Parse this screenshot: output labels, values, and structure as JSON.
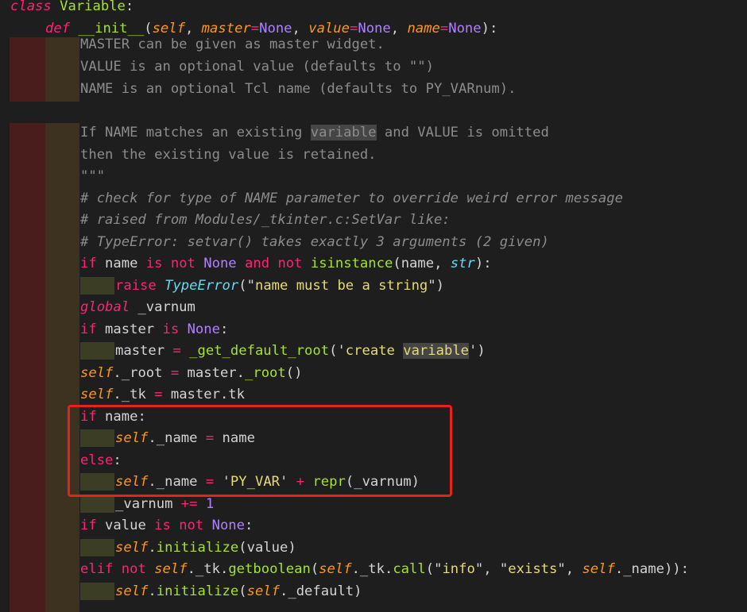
{
  "editor": {
    "colors": {
      "background": "#1e1e1e",
      "keyword": "#f92672",
      "function_name": "#a6e22e",
      "parameter": "#fd971f",
      "constant": "#ae81ff",
      "string": "#e6db74",
      "comment": "#8c8c8c",
      "builtin_type": "#66d9ef",
      "text": "#d4d4d4",
      "indent_guide_red": "#4a1d1d",
      "indent_guide_brown": "#3d3220",
      "indent_guide_olive": "#3b3d24",
      "highlight_box": "#e5231b"
    },
    "lines": [
      [
        [
          "class",
          "kw it"
        ],
        [
          " "
        ],
        [
          "Variable",
          "fn"
        ],
        [
          ":",
          "pn"
        ]
      ],
      [
        [
          "def",
          "kw it"
        ],
        [
          " "
        ],
        [
          "__init__",
          "fn"
        ],
        [
          "(",
          "pn"
        ],
        [
          "self",
          "par it"
        ],
        [
          ", ",
          "pn"
        ],
        [
          "master",
          "par it"
        ],
        [
          "=",
          "kw"
        ],
        [
          "None",
          "cst"
        ],
        [
          ", ",
          "pn"
        ],
        [
          "value",
          "par it"
        ],
        [
          "=",
          "kw"
        ],
        [
          "None",
          "cst"
        ],
        [
          ", ",
          "pn"
        ],
        [
          "name",
          "par it"
        ],
        [
          "=",
          "kw"
        ],
        [
          "None",
          "cst"
        ],
        [
          "):",
          "pn"
        ]
      ],
      [
        [
          "MASTER can be given as master widget.",
          "cm"
        ]
      ],
      [
        [
          "VALUE is an optional value (defaults to \"\")",
          "cm"
        ]
      ],
      [
        [
          "NAME is an optional Tcl name (defaults to PY_VARnum).",
          "cm"
        ]
      ],
      [],
      [
        [
          "If NAME matches an existing ",
          "cm"
        ],
        [
          "variable",
          "cm hl"
        ],
        [
          " and VALUE is omitted",
          "cm"
        ]
      ],
      [
        [
          "then the existing value is retained.",
          "cm"
        ]
      ],
      [
        [
          "\"\"\"",
          "cm"
        ]
      ],
      [
        [
          "# check for type of NAME parameter to override weird error message",
          "cm it"
        ]
      ],
      [
        [
          "# raised from Modules/_tkinter.c:SetVar like:",
          "cm it"
        ]
      ],
      [
        [
          "# TypeError: setvar() takes exactly 3 arguments (2 given)",
          "cm it"
        ]
      ],
      [
        [
          "if",
          "kw"
        ],
        [
          " name "
        ],
        [
          "is",
          "kw"
        ],
        [
          " "
        ],
        [
          "not",
          "kw"
        ],
        [
          " "
        ],
        [
          "None",
          "cst"
        ],
        [
          " "
        ],
        [
          "and",
          "kw"
        ],
        [
          " "
        ],
        [
          "not",
          "kw"
        ],
        [
          " "
        ],
        [
          "isinstance",
          "fn"
        ],
        [
          "(",
          "pn"
        ],
        [
          "name"
        ],
        [
          ", ",
          "pn"
        ],
        [
          "str",
          "bt it"
        ],
        [
          "):",
          "pn"
        ]
      ],
      [
        [
          "raise",
          "kw"
        ],
        [
          " "
        ],
        [
          "TypeError",
          "bt it"
        ],
        [
          "(",
          "pn"
        ],
        [
          "\"",
          "pn"
        ],
        [
          "name must be a string",
          "str"
        ],
        [
          "\"",
          "pn"
        ],
        [
          ")",
          "pn"
        ]
      ],
      [
        [
          "global",
          "kw it"
        ],
        [
          " _varnum"
        ]
      ],
      [
        [
          "if",
          "kw"
        ],
        [
          " master "
        ],
        [
          "is",
          "kw"
        ],
        [
          " "
        ],
        [
          "None",
          "cst"
        ],
        [
          ":",
          "pn"
        ]
      ],
      [
        [
          "master "
        ],
        [
          "=",
          "kw"
        ],
        [
          " "
        ],
        [
          "_get_default_root",
          "fn"
        ],
        [
          "(",
          "pn"
        ],
        [
          "'",
          "pn"
        ],
        [
          "create ",
          "str"
        ],
        [
          "variable",
          "str hl"
        ],
        [
          "'",
          "pn"
        ],
        [
          ")",
          "pn"
        ]
      ],
      [
        [
          "self",
          "par it"
        ],
        [
          "._root "
        ],
        [
          "=",
          "kw"
        ],
        [
          " master."
        ],
        [
          "_root",
          "fn"
        ],
        [
          "()",
          "pn"
        ]
      ],
      [
        [
          "self",
          "par it"
        ],
        [
          "._tk "
        ],
        [
          "=",
          "kw"
        ],
        [
          " master.tk"
        ]
      ],
      [
        [
          "if",
          "kw"
        ],
        [
          " name"
        ],
        [
          ":",
          "pn"
        ]
      ],
      [
        [
          "self",
          "par it"
        ],
        [
          "._name "
        ],
        [
          "=",
          "kw"
        ],
        [
          " name"
        ]
      ],
      [
        [
          "else",
          "kw"
        ],
        [
          ":",
          "pn"
        ]
      ],
      [
        [
          "self",
          "par it"
        ],
        [
          "._name "
        ],
        [
          "=",
          "kw"
        ],
        [
          " "
        ],
        [
          "'",
          "pn"
        ],
        [
          "PY_VAR",
          "str"
        ],
        [
          "'",
          "pn"
        ],
        [
          " "
        ],
        [
          "+",
          "kw"
        ],
        [
          " "
        ],
        [
          "repr",
          "fn"
        ],
        [
          "(",
          "pn"
        ],
        [
          "_varnum"
        ],
        [
          ")",
          "pn"
        ]
      ],
      [
        [
          "_varnum "
        ],
        [
          "+=",
          "kw"
        ],
        [
          " "
        ],
        [
          "1",
          "cst"
        ]
      ],
      [
        [
          "if",
          "kw"
        ],
        [
          " value "
        ],
        [
          "is",
          "kw"
        ],
        [
          " "
        ],
        [
          "not",
          "kw"
        ],
        [
          " "
        ],
        [
          "None",
          "cst"
        ],
        [
          ":",
          "pn"
        ]
      ],
      [
        [
          "self",
          "par it"
        ],
        [
          "."
        ],
        [
          "initialize",
          "fn"
        ],
        [
          "(",
          "pn"
        ],
        [
          "value"
        ],
        [
          ")",
          "pn"
        ]
      ],
      [
        [
          "elif",
          "kw"
        ],
        [
          " "
        ],
        [
          "not",
          "kw"
        ],
        [
          " "
        ],
        [
          "self",
          "par it"
        ],
        [
          "._tk."
        ],
        [
          "getboolean",
          "fn"
        ],
        [
          "(",
          "pn"
        ],
        [
          "self",
          "par it"
        ],
        [
          "._tk."
        ],
        [
          "call",
          "fn"
        ],
        [
          "(",
          "pn"
        ],
        [
          "\"",
          "pn"
        ],
        [
          "info",
          "str"
        ],
        [
          "\"",
          "pn"
        ],
        [
          ", ",
          "pn"
        ],
        [
          "\"",
          "pn"
        ],
        [
          "exists",
          "str"
        ],
        [
          "\"",
          "pn"
        ],
        [
          ", ",
          "pn"
        ],
        [
          "self",
          "par it"
        ],
        [
          "._name"
        ],
        [
          "))",
          "pn"
        ],
        [
          ":",
          "pn"
        ]
      ],
      [
        [
          "self",
          "par it"
        ],
        [
          "."
        ],
        [
          "initialize",
          "fn"
        ],
        [
          "(",
          "pn"
        ],
        [
          "self",
          "par it"
        ],
        [
          "._default"
        ],
        [
          ")",
          "pn"
        ]
      ]
    ]
  }
}
